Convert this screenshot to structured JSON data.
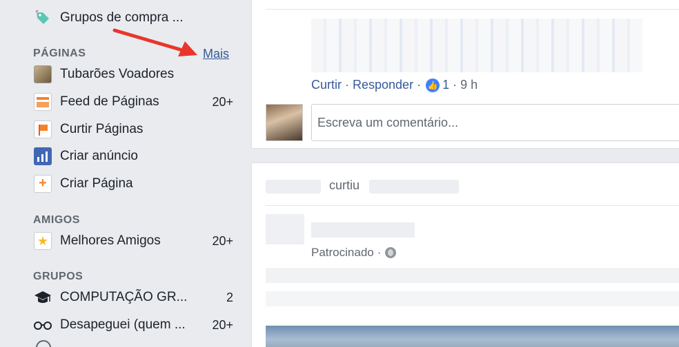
{
  "sidebar": {
    "top_item": {
      "label": "Grupos de compra ...",
      "icon": "tag-icon"
    },
    "pages": {
      "title": "PÁGINAS",
      "more_label": "Mais",
      "items": [
        {
          "label": "Tubarões Voadores",
          "count": "",
          "icon": "page-thumbnail-icon"
        },
        {
          "label": "Feed de Páginas",
          "count": "20+",
          "icon": "pages-feed-icon"
        },
        {
          "label": "Curtir Páginas",
          "count": "",
          "icon": "flag-icon"
        },
        {
          "label": "Criar anúncio",
          "count": "",
          "icon": "bar-chart-icon"
        },
        {
          "label": "Criar Página",
          "count": "",
          "icon": "plus-icon"
        }
      ]
    },
    "friends": {
      "title": "AMIGOS",
      "items": [
        {
          "label": "Melhores Amigos",
          "count": "20+",
          "icon": "star-icon"
        }
      ]
    },
    "groups": {
      "title": "GRUPOS",
      "items": [
        {
          "label": "COMPUTAÇÃO GR...",
          "count": "2",
          "icon": "graduation-cap-icon"
        },
        {
          "label": "Desapeguei (quem ...",
          "count": "20+",
          "icon": "glasses-icon"
        }
      ]
    }
  },
  "feed": {
    "comment": {
      "like_action": "Curtir",
      "reply_action": "Responder",
      "like_count": "1",
      "time": "9 h",
      "input_placeholder": "Escreva um comentário..."
    },
    "post": {
      "liked_text": "curtiu",
      "sponsored_label": "Patrocinado"
    }
  },
  "colors": {
    "link": "#365899",
    "annotation_arrow": "#e8362b",
    "like_badge": "#4080ff"
  }
}
